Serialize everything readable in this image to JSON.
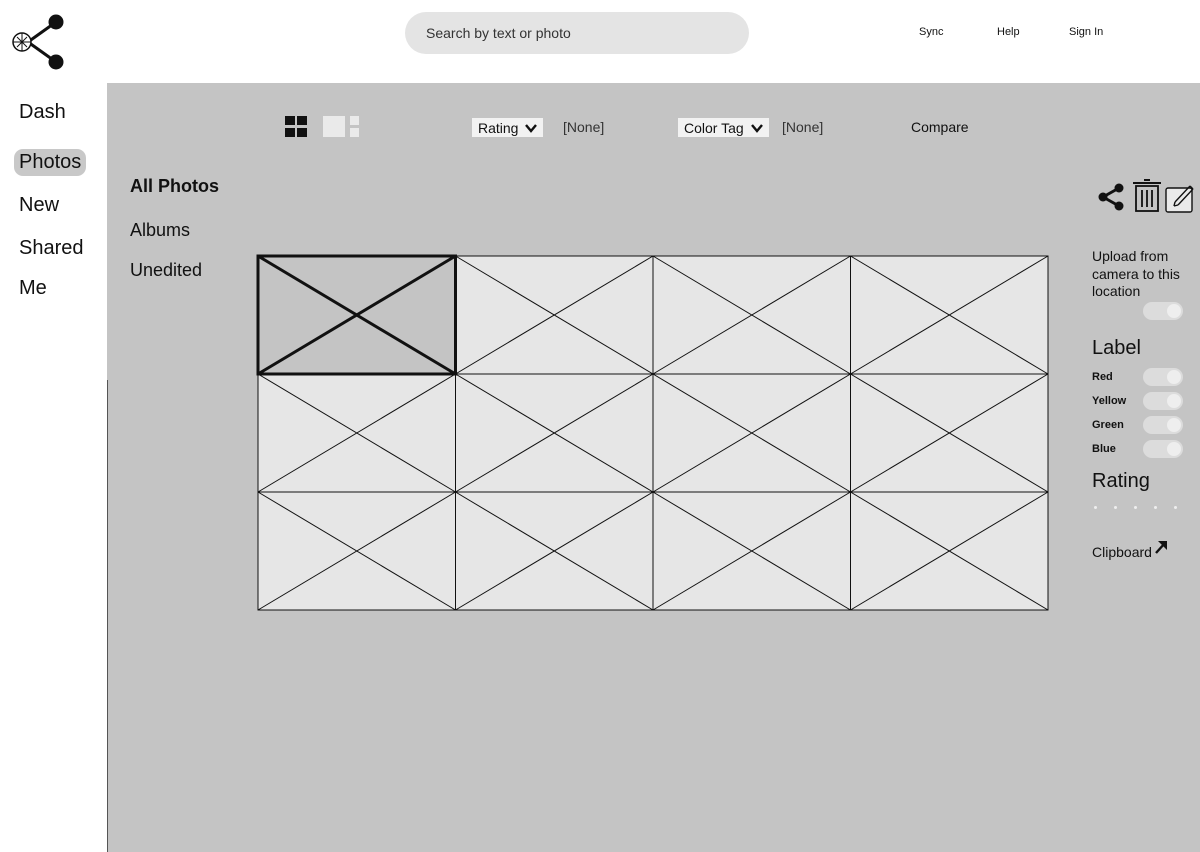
{
  "header": {
    "search_placeholder": "Search by text or photo",
    "nav": {
      "sync": "Sync",
      "help": "Help",
      "sign_in": "Sign In"
    }
  },
  "sidebar": {
    "items": [
      {
        "label": "Dash",
        "active": false
      },
      {
        "label": "Photos",
        "active": true
      },
      {
        "label": "New",
        "active": false
      },
      {
        "label": "Shared",
        "active": false
      },
      {
        "label": "Me",
        "active": false
      }
    ]
  },
  "toolbar": {
    "rating_label": "Rating",
    "rating_value": "[None]",
    "color_tag_label": "Color Tag",
    "color_tag_value": "[None]",
    "compare_label": "Compare"
  },
  "sections": {
    "all_photos": "All Photos",
    "albums": "Albums",
    "unedited": "Unedited"
  },
  "grid": {
    "rows": 3,
    "cols": 4,
    "selected_index": 0
  },
  "panel": {
    "upload_text_line1": "Upload from",
    "upload_text_line2": "camera to this",
    "upload_text_line3": "location",
    "label_heading": "Label",
    "labels": [
      "Red",
      "Yellow",
      "Green",
      "Blue"
    ],
    "rating_heading": "Rating",
    "rating_stars": 0,
    "rating_max": 5,
    "clipboard_label": "Clipboard"
  },
  "icons": [
    "share-logo-icon",
    "grid-view-icon",
    "list-view-icon",
    "chevron-down-icon",
    "share-icon",
    "trash-icon",
    "edit-icon",
    "arrow-icon"
  ]
}
